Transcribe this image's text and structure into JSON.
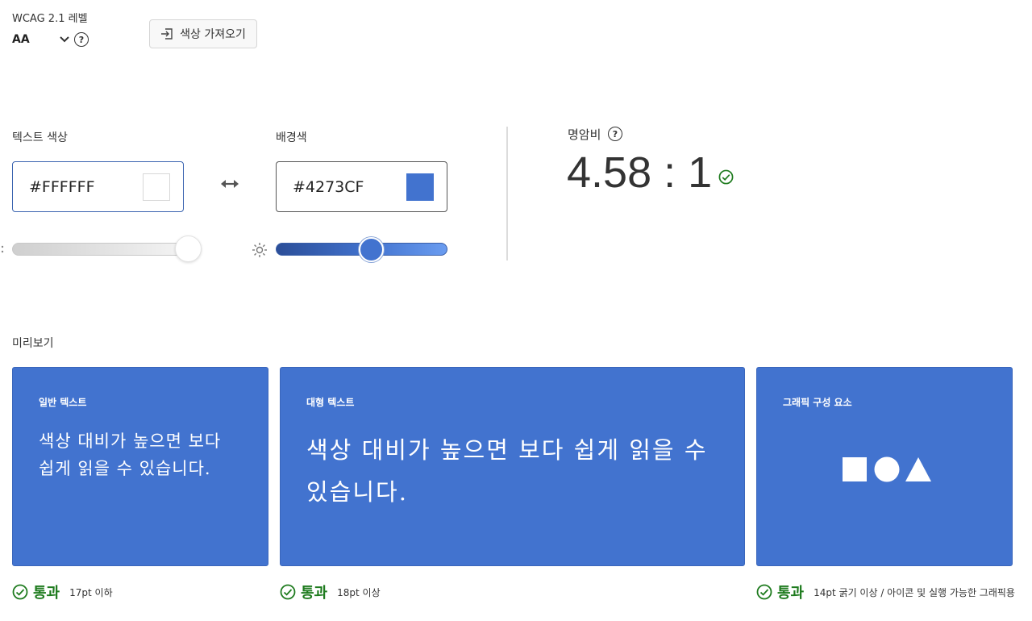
{
  "wcag": {
    "label": "WCAG 2.1 레벨",
    "level_value": "AA",
    "help": "?"
  },
  "import_button": {
    "label": "색상 가져오기"
  },
  "text_color": {
    "label": "텍스트 색상",
    "value": "#FFFFFF",
    "swatch_color": "#FFFFFF",
    "slider_level": 1.0
  },
  "background_color": {
    "label": "배경색",
    "value": "#4273CF",
    "swatch_color": "#4273CF",
    "slider_level": 0.55
  },
  "contrast": {
    "label": "명암비",
    "help": "?",
    "ratio": "4.58 : 1",
    "status": "pass"
  },
  "preview": {
    "label": "미리보기",
    "cards": {
      "normal": {
        "title": "일반 텍스트",
        "sample": "색상 대비가 높으면 보다 쉽게 읽을 수 있습니다.",
        "result": "통과",
        "note": "17pt 이하"
      },
      "large": {
        "title": "대형 텍스트",
        "sample": "색상 대비가 높으면 보다 쉽게 읽을 수 있습니다.",
        "result": "통과",
        "note": "18pt 이상"
      },
      "graphic": {
        "title": "그래픽 구성 요소",
        "result": "통과",
        "note": "14pt 굵기 이상 / 아이콘 및 실행 가능한 그래픽용"
      }
    }
  },
  "colors": {
    "accent": "#4273CF",
    "pass_green": "#1E7B1E",
    "focus_border": "#3B64B0"
  }
}
